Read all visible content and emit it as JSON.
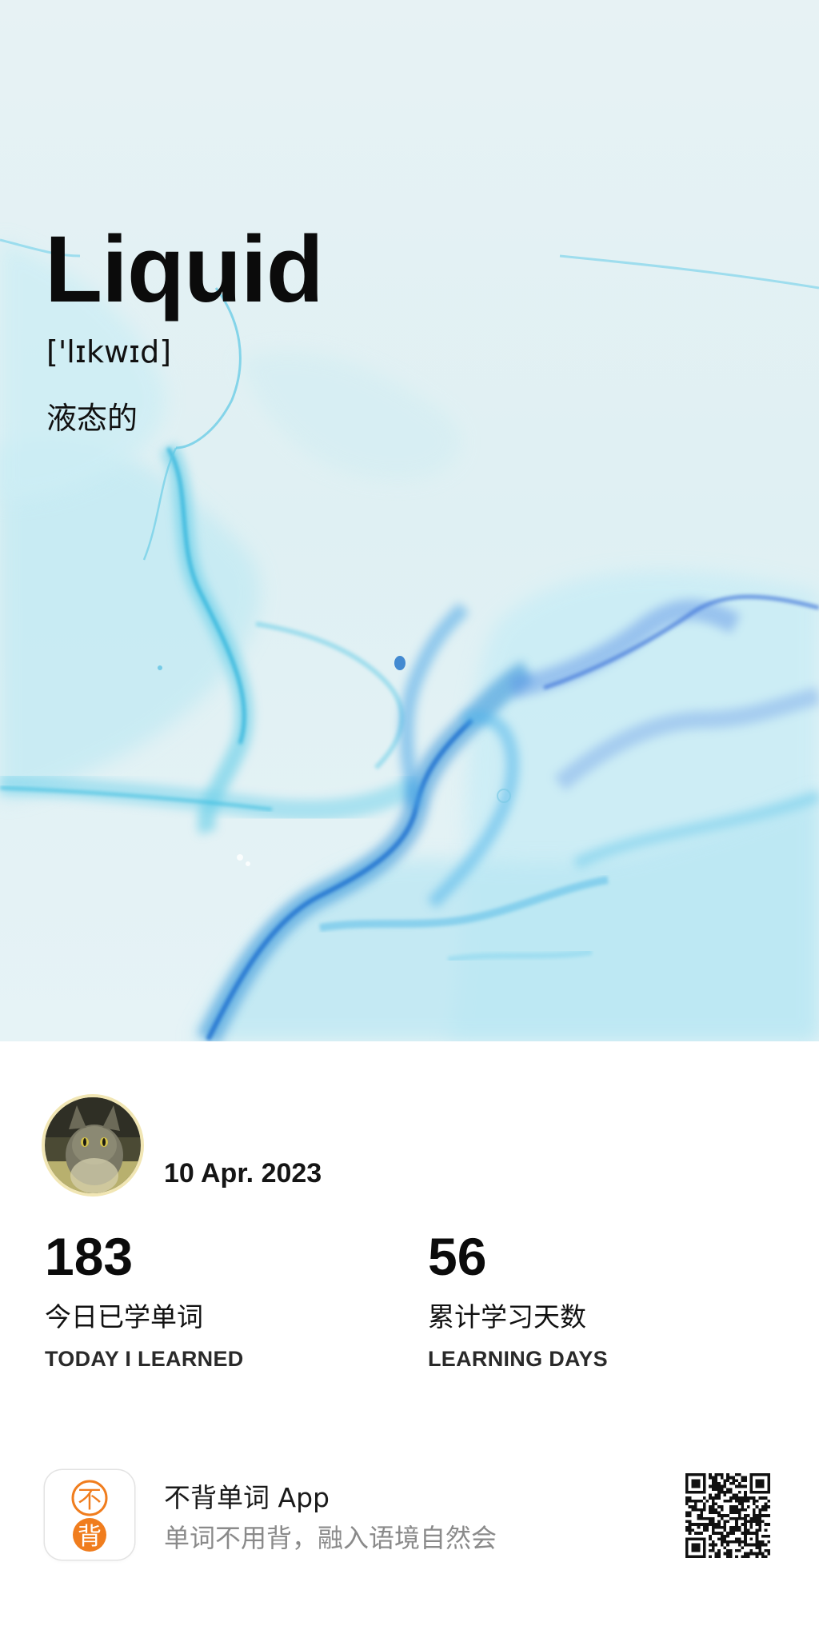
{
  "hero": {
    "word": "Liquid",
    "phonetic": "['lɪkwɪd]",
    "meaning": "液态的"
  },
  "profile": {
    "date": "10 Apr. 2023"
  },
  "stats": {
    "today": {
      "value": "183",
      "label_cn": "今日已学单词",
      "label_en": "TODAY I LEARNED"
    },
    "days": {
      "value": "56",
      "label_cn": "累计学习天数",
      "label_en": "LEARNING DAYS"
    }
  },
  "footer": {
    "icon_chars": [
      "不",
      "背"
    ],
    "app_name": "不背单词 App",
    "tagline": "单词不用背，融入语境自然会"
  },
  "colors": {
    "background": "#ffffff",
    "hero_base": "#e3f0f3",
    "accent_cyan": "#3fc6e0",
    "accent_blue": "#4a86e0",
    "brand_orange": "#f07d1e"
  }
}
